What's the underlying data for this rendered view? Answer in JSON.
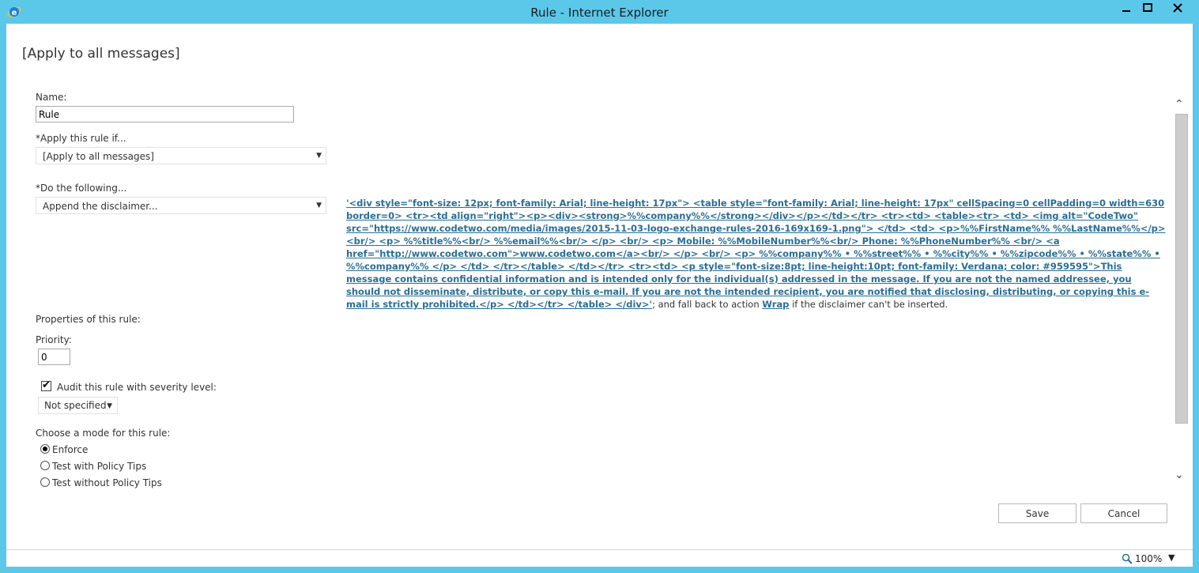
{
  "window": {
    "title": "Rule - Internet Explorer",
    "minimize": "▁",
    "maximize": "□",
    "close": "✕"
  },
  "page": {
    "title": "[Apply to all messages]"
  },
  "form": {
    "name_label": "Name:",
    "name_value": "Rule",
    "apply_if_label": "*Apply this rule if...",
    "apply_if_value": "[Apply to all messages]",
    "do_following_label": "*Do the following...",
    "do_following_value": "Append the disclaimer...",
    "disclaimer": {
      "text": "'<div style=\"font-size: 12px; font-family: Arial; line-height: 17px\"> <table style=\"font-family: Arial; line-height: 17px\" cellSpacing=0 cellPadding=0 width=630 border=0> <tr><td align=\"right\"><p><div><strong>%%company%%</strong></div></p></td></tr> <tr><td> <table><tr> <td> <img alt=\"CodeTwo\" src=\"https://www.codetwo.com/media/images/2015-11-03-logo-exchange-rules-2016-169x169-1.png\"> </td> <td> <p>%%FirstName%% %%LastName%%</p> <br/> <p> %%title%%<br/> %%email%%<br/> </p> <br/> <p> Mobile: %%MobileNumber%%<br/> Phone: %%PhoneNumber%% <br/> <a href=\"http://www.codetwo.com\">www.codetwo.com</a><br/> </p> <br/> <p> %%company%% • %%street%% • %%city%% • %%zipcode%% • %%state%% • %%company%% </p> </td> </tr></table> </td></tr> <tr><td> <p style=\"font-size:8pt; line-height:10pt; font-family: Verdana; color: #959595\">This message contains confidential information and is intended only for the individual(s) addressed in the message. If you are not the named addressee, you should not disseminate, distribute, or copy this e-mail. If you are not the intended recipient, you are notified that disclosing, distributing, or copying this e-mail is strictly prohibited.</p> </td></tr> </table> </div>'",
      "middle": "; and fall back to action ",
      "action": "Wrap",
      "suffix": " if the disclaimer can't be inserted."
    },
    "properties_label": "Properties of this rule:",
    "priority_label": "Priority:",
    "priority_value": "0",
    "audit_label": "Audit this rule with severity level:",
    "audit_checked": true,
    "severity_value": "Not specified",
    "mode_label": "Choose a mode for this rule:",
    "modes": [
      {
        "label": "Enforce",
        "selected": true
      },
      {
        "label": "Test with Policy Tips",
        "selected": false
      },
      {
        "label": "Test without Policy Tips",
        "selected": false
      }
    ]
  },
  "buttons": {
    "save": "Save",
    "cancel": "Cancel"
  },
  "statusbar": {
    "zoom": "100%"
  },
  "icons": {
    "caret": "▼",
    "check": "✔",
    "scroll_up": "⌃",
    "scroll_down": "⌄"
  },
  "colors": {
    "frame": "#5bc8ea",
    "link": "#2a6e96"
  }
}
